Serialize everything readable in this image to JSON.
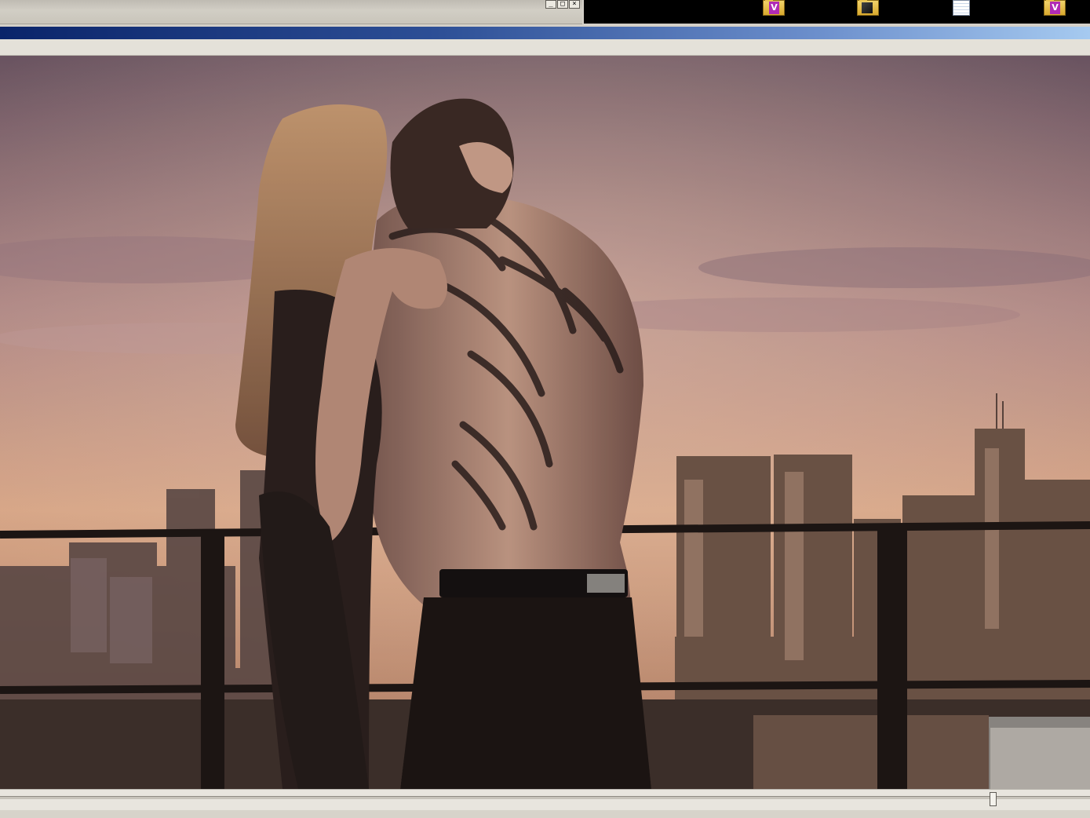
{
  "window": {
    "controls": {
      "minimize_glyph": "_",
      "maximize_glyph": "□",
      "close_glyph": "×"
    }
  },
  "desktop": {
    "icons": [
      {
        "icon": "video-folder-icon"
      },
      {
        "icon": "photo-folder-icon"
      },
      {
        "icon": "text-file-icon"
      },
      {
        "icon": "video-folder-icon"
      }
    ]
  },
  "player": {
    "seek_fraction": 0.911,
    "frame": {
      "sky_top": "#6e5866",
      "sky_mid": "#b88f8d",
      "horizon": "#e3b08f",
      "skyline": "#5b4840",
      "foreground": "#2b211e"
    }
  }
}
